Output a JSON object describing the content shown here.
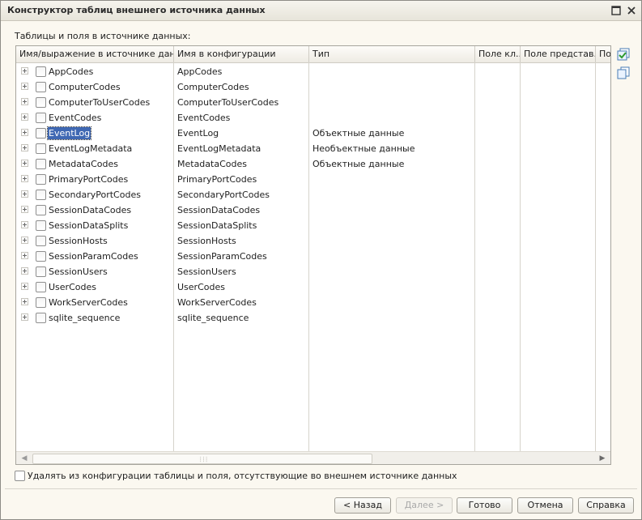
{
  "window": {
    "title": "Конструктор таблиц внешнего источника данных",
    "max_icon": "maximize-icon",
    "close_icon": "close-icon"
  },
  "caption": "Таблицы и поля в источнике данных:",
  "table": {
    "columns": [
      "Имя/выражение в источнике данн...",
      "Имя в конфигурации",
      "Тип",
      "Поле кл...",
      "Поле представ...",
      "По"
    ],
    "rows": [
      {
        "name": "AppCodes",
        "config": "AppCodes",
        "type": "",
        "checked": false,
        "selected": false
      },
      {
        "name": "ComputerCodes",
        "config": "ComputerCodes",
        "type": "",
        "checked": false,
        "selected": false
      },
      {
        "name": "ComputerToUserCodes",
        "config": "ComputerToUserCodes",
        "type": "",
        "checked": false,
        "selected": false
      },
      {
        "name": "EventCodes",
        "config": "EventCodes",
        "type": "",
        "checked": false,
        "selected": false
      },
      {
        "name": "EventLog",
        "config": "EventLog",
        "type": "Объектные данные",
        "checked": false,
        "selected": true
      },
      {
        "name": "EventLogMetadata",
        "config": "EventLogMetadata",
        "type": "Необъектные данные",
        "checked": false,
        "selected": false
      },
      {
        "name": "MetadataCodes",
        "config": "MetadataCodes",
        "type": "Объектные данные",
        "checked": false,
        "selected": false
      },
      {
        "name": "PrimaryPortCodes",
        "config": "PrimaryPortCodes",
        "type": "",
        "checked": false,
        "selected": false
      },
      {
        "name": "SecondaryPortCodes",
        "config": "SecondaryPortCodes",
        "type": "",
        "checked": false,
        "selected": false
      },
      {
        "name": "SessionDataCodes",
        "config": "SessionDataCodes",
        "type": "",
        "checked": false,
        "selected": false
      },
      {
        "name": "SessionDataSplits",
        "config": "SessionDataSplits",
        "type": "",
        "checked": false,
        "selected": false
      },
      {
        "name": "SessionHosts",
        "config": "SessionHosts",
        "type": "",
        "checked": false,
        "selected": false
      },
      {
        "name": "SessionParamCodes",
        "config": "SessionParamCodes",
        "type": "",
        "checked": false,
        "selected": false
      },
      {
        "name": "SessionUsers",
        "config": "SessionUsers",
        "type": "",
        "checked": false,
        "selected": false
      },
      {
        "name": "UserCodes",
        "config": "UserCodes",
        "type": "",
        "checked": false,
        "selected": false
      },
      {
        "name": "WorkServerCodes",
        "config": "WorkServerCodes",
        "type": "",
        "checked": false,
        "selected": false
      },
      {
        "name": "sqlite_sequence",
        "config": "sqlite_sequence",
        "type": "",
        "checked": false,
        "selected": false
      }
    ]
  },
  "side_icons": [
    "check-all-icon",
    "copy-icon"
  ],
  "bottom_checkbox": {
    "label": "Удалять из конфигурации таблицы и поля, отсутствующие во внешнем источнике данных",
    "checked": false
  },
  "buttons": {
    "back": "< Назад",
    "next": "Далее >",
    "done": "Готово",
    "cancel": "Отмена",
    "help": "Справка"
  },
  "colors": {
    "selection": "#3f68b3",
    "background": "#fbf8f0"
  }
}
